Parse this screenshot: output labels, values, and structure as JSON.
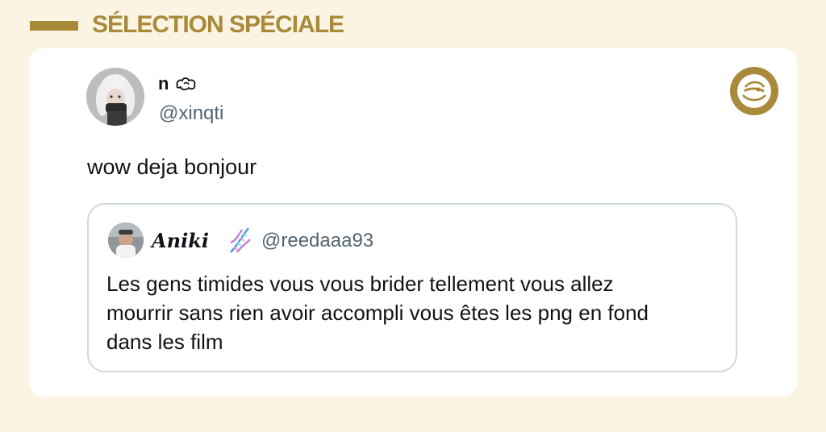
{
  "header": {
    "title": "SÉLECTION SPÉCIALE"
  },
  "post": {
    "author_name": "n ",
    "name_icon": "cloud-doodle-icon",
    "author_handle": "@xinqti",
    "text": "wow deja bonjour",
    "brand_icon": "brand-seal-icon"
  },
  "quote": {
    "author_name": "𝑨𝒏𝒊𝒌𝒊",
    "name_icon": "dna-icon",
    "author_handle": "@reedaaa93",
    "text": "Les gens timides vous vous brider tellement vous allez\nmourrir sans rien avoir accompli vous êtes les png en fond\ndans les film"
  },
  "colors": {
    "background": "#fbf4e3",
    "accent": "#a98a3b",
    "card": "#ffffff",
    "text_primary": "#0f1419",
    "text_secondary": "#536471",
    "border": "#cfd9de"
  }
}
